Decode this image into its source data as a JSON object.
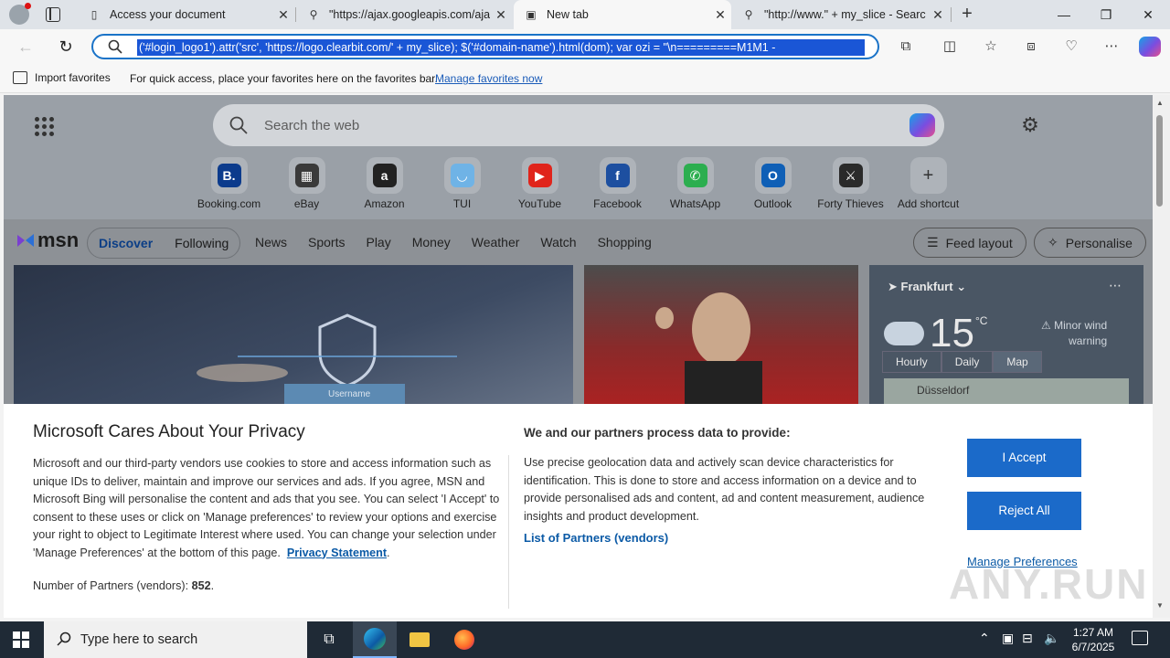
{
  "browser": {
    "tabs": [
      {
        "title": "Access your document",
        "icon": "document-icon"
      },
      {
        "title": "\"https://ajax.googleapis.com/aja",
        "icon": "search-icon"
      },
      {
        "title": "New tab",
        "icon": "newtab-icon",
        "active": true
      },
      {
        "title": "\"http://www.\" + my_slice - Searc",
        "icon": "search-icon"
      }
    ],
    "address": "('#login_logo1').attr('src', 'https://logo.clearbit.com/' + my_slice); $('#domain-name').html(dom); var ozi = \"\\n=========M1M1 -",
    "favorites": {
      "import_label": "Import favorites",
      "hint": "For quick access, place your favorites here on the favorites bar.",
      "manage_link": "Manage favorites now"
    }
  },
  "newtab": {
    "search_placeholder": "Search the web",
    "shortcuts": [
      {
        "label": "Booking.com",
        "icon": "booking-icon",
        "color": "#0c3b8c",
        "glyph": "B."
      },
      {
        "label": "eBay",
        "icon": "ebay-icon",
        "color": "#3a3a3a",
        "glyph": "▦"
      },
      {
        "label": "Amazon",
        "icon": "amazon-icon",
        "color": "#222222",
        "glyph": "a"
      },
      {
        "label": "TUI",
        "icon": "tui-icon",
        "color": "#6fb3e6",
        "glyph": "◡"
      },
      {
        "label": "YouTube",
        "icon": "youtube-icon",
        "color": "#e0241b",
        "glyph": "▶"
      },
      {
        "label": "Facebook",
        "icon": "facebook-icon",
        "color": "#1d4fa0",
        "glyph": "f"
      },
      {
        "label": "WhatsApp",
        "icon": "whatsapp-icon",
        "color": "#2cae4f",
        "glyph": "✆"
      },
      {
        "label": "Outlook",
        "icon": "outlook-icon",
        "color": "#0f5fb6",
        "glyph": "O"
      },
      {
        "label": "Forty Thieves",
        "icon": "forty-thieves-icon",
        "color": "#2a2a2a",
        "glyph": "⚔"
      },
      {
        "label": "Add shortcut",
        "icon": "plus-icon",
        "color": "#aeb3b9",
        "glyph": "+"
      }
    ],
    "msn": {
      "logo": "msn",
      "pills": [
        "Discover",
        "Following"
      ],
      "nav": [
        "News",
        "Sports",
        "Play",
        "Money",
        "Weather",
        "Watch",
        "Shopping"
      ],
      "feed_layout": "Feed layout",
      "personalise": "Personalise"
    },
    "card1": {
      "label": "Username"
    },
    "weather": {
      "location": "Frankfurt",
      "temp": "15",
      "unit": "°C",
      "warning_line1": "Minor wind",
      "warning_line2": "warning",
      "tabs": [
        "Hourly",
        "Daily",
        "Map"
      ],
      "map_city": "Düsseldorf"
    }
  },
  "privacy": {
    "title": "Microsoft Cares About Your Privacy",
    "body": "Microsoft and our third-party vendors use cookies to store and access information such as unique IDs to deliver, maintain and improve our services and ads. If you agree, MSN and Microsoft Bing will personalise the content and ads that you see. You can select 'I Accept' to consent to these uses or click on 'Manage preferences' to review your options and exercise your right to object to Legitimate Interest where used.  You can change your selection under 'Manage Preferences' at the bottom of this page.",
    "statement_link": "Privacy Statement",
    "partners_label": "Number of Partners (vendors):",
    "partners_count": "852",
    "right_title": "We and our partners process data to provide:",
    "right_body": "Use precise geolocation data and actively scan device characteristics for identification. This is done to store and access information on a device and to provide personalised ads and content, ad and content measurement, audience insights and product development.",
    "list_link": "List of Partners (vendors)",
    "accept": "I Accept",
    "reject": "Reject All",
    "manage": "Manage Preferences",
    "watermark": "ANY.RUN"
  },
  "taskbar": {
    "search_placeholder": "Type here to search",
    "time": "1:27 AM",
    "date": "6/7/2025"
  }
}
